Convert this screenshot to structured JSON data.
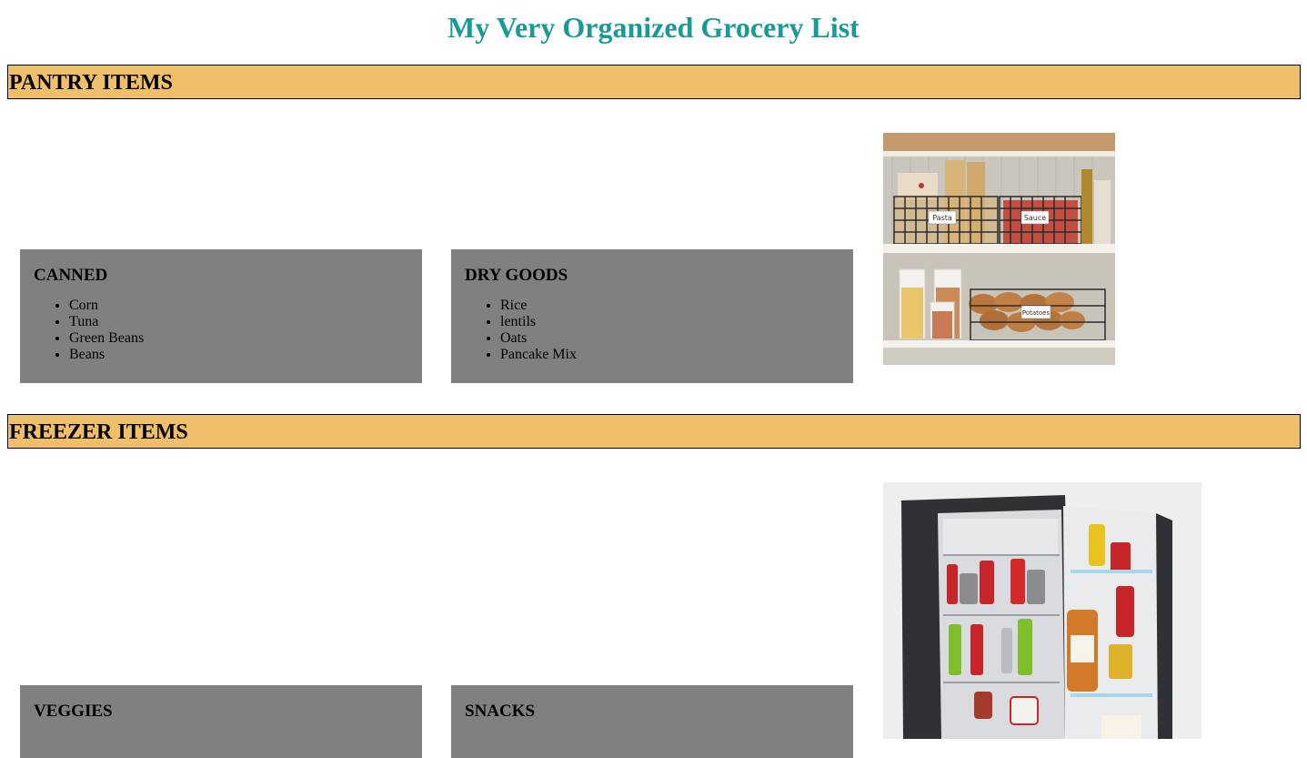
{
  "page": {
    "title": "My Very Organized Grocery List"
  },
  "sections": [
    {
      "header": "PANTRY ITEMS",
      "cards": [
        {
          "title": "CANNED",
          "items": [
            "Corn",
            "Tuna",
            "Green Beans",
            "Beans"
          ]
        },
        {
          "title": "DRY GOODS",
          "items": [
            "Rice",
            "lentils",
            "Oats",
            "Pancake Mix"
          ]
        }
      ],
      "photo": {
        "subject": "pantry shelves with labeled wire baskets",
        "labels": [
          "Pasta",
          "Sauce",
          "Potatoes"
        ]
      }
    },
    {
      "header": "FREEZER ITEMS",
      "cards": [
        {
          "title": "VEGGIES",
          "items": []
        },
        {
          "title": "SNACKS",
          "items": []
        }
      ],
      "photo": {
        "subject": "open mini fridge stocked with drinks and condiments"
      }
    }
  ],
  "colors": {
    "title": "#1a9a96",
    "section_header_bg": "#f0bf6b",
    "card_bg": "#808080"
  }
}
